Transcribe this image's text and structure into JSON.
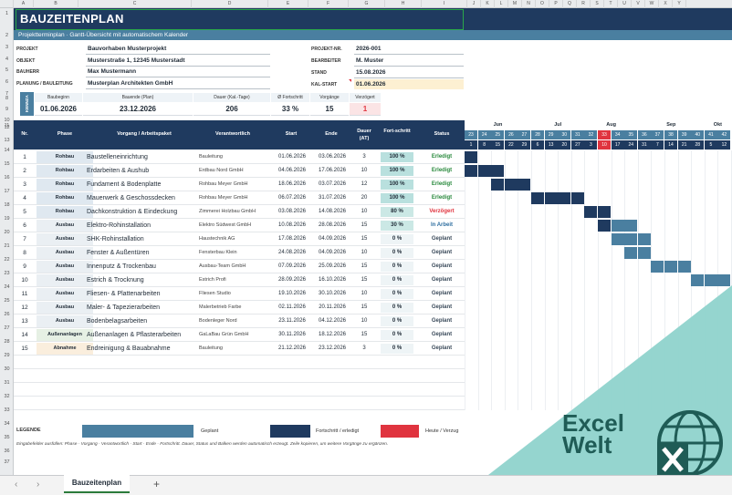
{
  "columns": [
    "A",
    "B",
    "C",
    "D",
    "E",
    "F",
    "G",
    "H",
    "I",
    "J",
    "K",
    "L",
    "M",
    "N",
    "O",
    "P",
    "Q",
    "R",
    "S",
    "T",
    "U",
    "V",
    "W",
    "X",
    "Y"
  ],
  "rows": [
    "1",
    "2",
    "3",
    "4",
    "5",
    "6",
    "7",
    "8",
    "9",
    "10",
    "11",
    "12",
    "13",
    "14",
    "15",
    "16",
    "17",
    "18",
    "19",
    "20",
    "21",
    "22",
    "23",
    "24",
    "25",
    "26",
    "27",
    "28",
    "29",
    "30",
    "31",
    "32",
    "33",
    "34",
    "35",
    "36",
    "37"
  ],
  "header": {
    "title": "BAUZEITENPLAN",
    "subtitle": "Projektterminplan  ·  Gantt-Übersicht mit automatischem Kalender"
  },
  "meta": {
    "projekt_lbl": "PROJEKT",
    "projekt": "Bauvorhaben Musterprojekt",
    "objekt_lbl": "OBJEKT",
    "objekt": "Musterstraße 1, 12345 Musterstadt",
    "bauherr_lbl": "BAUHERR",
    "bauherr": "Max Mustermann",
    "planung_lbl": "PLANUNG / BAULEITUNG",
    "planung": "Musterplan Architekten GmbH",
    "projnr_lbl": "PROJEKT-NR.",
    "projnr": "2026-001",
    "bearbeiter_lbl": "BEARBEITER",
    "bearbeiter": "M. Muster",
    "stand_lbl": "STAND",
    "stand": "15.08.2026",
    "kalstart_lbl": "KAL-START",
    "kalstart": "01.06.2026"
  },
  "kpi": {
    "side": "KENNZA",
    "baubeginn_lbl": "Baubeginn",
    "baubeginn": "01.06.2026",
    "bauende_lbl": "Bauende (Plan)",
    "bauende": "23.12.2026",
    "dauer_lbl": "Dauer (Kal.-Tage)",
    "dauer": "206",
    "fortschritt_lbl": "Ø Fortschritt",
    "fortschritt": "33 %",
    "vorgaenge_lbl": "Vorgänge",
    "vorgaenge": "15",
    "verzoegert_lbl": "Verzögert",
    "verzoegert": "1"
  },
  "table": {
    "h_nr": "Nr.",
    "h_phase": "Phase",
    "h_vorgang": "Vorgang / Arbeitspaket",
    "h_verantw": "Verantwortlich",
    "h_start": "Start",
    "h_ende": "Ende",
    "h_dauer": "Dauer (AT)",
    "h_fort": "Fort-schritt",
    "h_status": "Status",
    "rows": [
      {
        "nr": "1",
        "phase": "Rohbau",
        "vorgang": "Baustelleneinrichtung",
        "verantw": "Bauleitung",
        "start": "01.06.2026",
        "ende": "03.06.2026",
        "dauer": "3",
        "fort": "100 %",
        "status": "Erledigt"
      },
      {
        "nr": "2",
        "phase": "Rohbau",
        "vorgang": "Erdarbeiten & Aushub",
        "verantw": "Erdbau Nord GmbH",
        "start": "04.06.2026",
        "ende": "17.06.2026",
        "dauer": "10",
        "fort": "100 %",
        "status": "Erledigt"
      },
      {
        "nr": "3",
        "phase": "Rohbau",
        "vorgang": "Fundament & Bodenplatte",
        "verantw": "Rohbau Meyer GmbH",
        "start": "18.06.2026",
        "ende": "03.07.2026",
        "dauer": "12",
        "fort": "100 %",
        "status": "Erledigt"
      },
      {
        "nr": "4",
        "phase": "Rohbau",
        "vorgang": "Mauerwerk & Geschossdecken",
        "verantw": "Rohbau Meyer GmbH",
        "start": "06.07.2026",
        "ende": "31.07.2026",
        "dauer": "20",
        "fort": "100 %",
        "status": "Erledigt"
      },
      {
        "nr": "5",
        "phase": "Rohbau",
        "vorgang": "Dachkonstruktion & Eindeckung",
        "verantw": "Zimmerei Holzbau GmbH",
        "start": "03.08.2026",
        "ende": "14.08.2026",
        "dauer": "10",
        "fort": "80 %",
        "status": "Verzögert"
      },
      {
        "nr": "6",
        "phase": "Ausbau",
        "vorgang": "Elektro-Rohinstallation",
        "verantw": "Elektro Südwest GmbH",
        "start": "10.08.2026",
        "ende": "28.08.2026",
        "dauer": "15",
        "fort": "30 %",
        "status": "In Arbeit"
      },
      {
        "nr": "7",
        "phase": "Ausbau",
        "vorgang": "SHK-Rohinstallation",
        "verantw": "Haustechnik AG",
        "start": "17.08.2026",
        "ende": "04.09.2026",
        "dauer": "15",
        "fort": "0 %",
        "status": "Geplant"
      },
      {
        "nr": "8",
        "phase": "Ausbau",
        "vorgang": "Fenster & Außentüren",
        "verantw": "Fensterbau Klein",
        "start": "24.08.2026",
        "ende": "04.09.2026",
        "dauer": "10",
        "fort": "0 %",
        "status": "Geplant"
      },
      {
        "nr": "9",
        "phase": "Ausbau",
        "vorgang": "Innenputz & Trockenbau",
        "verantw": "Ausbau-Team GmbH",
        "start": "07.09.2026",
        "ende": "25.09.2026",
        "dauer": "15",
        "fort": "0 %",
        "status": "Geplant"
      },
      {
        "nr": "10",
        "phase": "Ausbau",
        "vorgang": "Estrich & Trocknung",
        "verantw": "Estrich Profi",
        "start": "28.09.2026",
        "ende": "16.10.2026",
        "dauer": "15",
        "fort": "0 %",
        "status": "Geplant"
      },
      {
        "nr": "11",
        "phase": "Ausbau",
        "vorgang": "Fliesen- & Plattenarbeiten",
        "verantw": "Fliesen Studio",
        "start": "19.10.2026",
        "ende": "30.10.2026",
        "dauer": "10",
        "fort": "0 %",
        "status": "Geplant"
      },
      {
        "nr": "12",
        "phase": "Ausbau",
        "vorgang": "Maler- & Tapezierarbeiten",
        "verantw": "Malerbetrieb Farbe",
        "start": "02.11.2026",
        "ende": "20.11.2026",
        "dauer": "15",
        "fort": "0 %",
        "status": "Geplant"
      },
      {
        "nr": "13",
        "phase": "Ausbau",
        "vorgang": "Bodenbelagsarbeiten",
        "verantw": "Bodenleger Nord",
        "start": "23.11.2026",
        "ende": "04.12.2026",
        "dauer": "10",
        "fort": "0 %",
        "status": "Geplant"
      },
      {
        "nr": "14",
        "phase": "Außenanlagen",
        "vorgang": "Außenanlagen & Pflasterarbeiten",
        "verantw": "GaLaBau Grün GmbH",
        "start": "30.11.2026",
        "ende": "18.12.2026",
        "dauer": "15",
        "fort": "0 %",
        "status": "Geplant"
      },
      {
        "nr": "15",
        "phase": "Abnahme",
        "vorgang": "Endreinigung & Bauabnahme",
        "verantw": "Bauleitung",
        "start": "21.12.2026",
        "ende": "23.12.2026",
        "dauer": "3",
        "fort": "0 %",
        "status": "Geplant"
      }
    ]
  },
  "gantt": {
    "months": [
      "Jun",
      "Jul",
      "Aug",
      "Sep",
      "Okt"
    ],
    "weeks": [
      "23",
      "24",
      "25",
      "26",
      "27",
      "28",
      "29",
      "30",
      "31",
      "32",
      "33",
      "34",
      "35",
      "36",
      "37",
      "38",
      "39",
      "40",
      "41",
      "42"
    ],
    "days": [
      "1",
      "8",
      "15",
      "22",
      "29",
      "6",
      "13",
      "20",
      "27",
      "3",
      "10",
      "17",
      "24",
      "31",
      "7",
      "14",
      "21",
      "28",
      "5",
      "12"
    ],
    "today_week_index": 10,
    "bars": [
      {
        "row": 0,
        "start": 0,
        "len": 1,
        "kind": "done"
      },
      {
        "row": 1,
        "start": 0,
        "len": 3,
        "kind": "done"
      },
      {
        "row": 2,
        "start": 2,
        "len": 3,
        "kind": "done"
      },
      {
        "row": 3,
        "start": 5,
        "len": 4,
        "kind": "done"
      },
      {
        "row": 4,
        "start": 9,
        "len": 2,
        "kind": "done"
      },
      {
        "row": 5,
        "start": 10,
        "len": 3,
        "kind": "mixed"
      },
      {
        "row": 6,
        "start": 11,
        "len": 3,
        "kind": "plan"
      },
      {
        "row": 7,
        "start": 12,
        "len": 2,
        "kind": "plan"
      },
      {
        "row": 8,
        "start": 14,
        "len": 3,
        "kind": "plan"
      },
      {
        "row": 9,
        "start": 17,
        "len": 3,
        "kind": "plan"
      }
    ],
    "colors": {
      "done": "#1f3a5f",
      "plan": "#4a7fa0",
      "today": "#e0343f",
      "weekhead": "#4a7fa0",
      "monthhead": "#1f3a5f"
    }
  },
  "legend": {
    "title": "LEGENDE",
    "geplant": "Geplant",
    "fortschritt": "Fortschritt / erledigt",
    "heute": "Heute / Verzug",
    "note": "Eingabefelder ausfüllen: Phase · Vorgang · Verantwortlich · Start · Ende · Fortschritt.  Dauer, Status und Balken werden automatisch erzeugt.  Zeile kopieren, um weitere Vorgänge zu ergänzen."
  },
  "brand": {
    "line1": "Excel",
    "line2": "Welt"
  },
  "sheet": {
    "tab": "Bauzeitenplan",
    "add": "+",
    "prev": "‹",
    "next": "›"
  }
}
